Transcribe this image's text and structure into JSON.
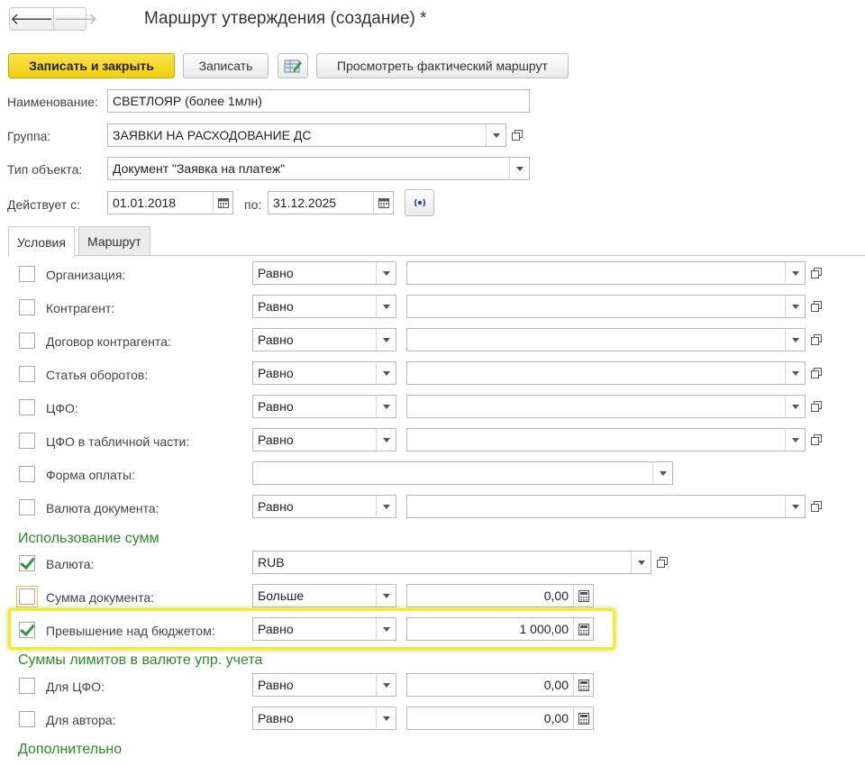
{
  "window": {
    "title": "Маршрут утверждения (создание) *"
  },
  "nav": {
    "back_icon": "arrow-left-icon",
    "forward_icon": "arrow-right-icon",
    "back_glyph": "🡐",
    "forward_glyph": "🡒"
  },
  "toolbar": {
    "save_close": "Записать и закрыть",
    "save": "Записать",
    "edit_icon": "edit-table-icon",
    "view_route": "Просмотреть фактический маршрут"
  },
  "header": {
    "name_label": "Наименование:",
    "name_value": "СВЕТЛОЯР (более 1млн)",
    "group_label": "Группа:",
    "group_value": "ЗАЯВКИ НА РАСХОДОВАНИЕ ДС",
    "object_type_label": "Тип объекта:",
    "object_type_value": "Документ \"Заявка на платеж\"",
    "valid_from_label": "Действует с:",
    "valid_from_value": "01.01.2018",
    "valid_to_label": "по:",
    "valid_to_value": "31.12.2025"
  },
  "tabs": [
    {
      "label": "Условия",
      "active": true
    },
    {
      "label": "Маршрут",
      "active": false
    }
  ],
  "conditions": [
    {
      "label": "Организация:",
      "checked": false,
      "operator": "Равно",
      "value": ""
    },
    {
      "label": "Контрагент:",
      "checked": false,
      "operator": "Равно",
      "value": ""
    },
    {
      "label": "Договор контрагента:",
      "checked": false,
      "operator": "Равно",
      "value": ""
    },
    {
      "label": "Статья оборотов:",
      "checked": false,
      "operator": "Равно",
      "value": ""
    },
    {
      "label": "ЦФО:",
      "checked": false,
      "operator": "Равно",
      "value": ""
    },
    {
      "label": "ЦФО в табличной части:",
      "checked": false,
      "operator": "Равно",
      "value": ""
    },
    {
      "label": "Форма оплаты:",
      "checked": false,
      "value": ""
    },
    {
      "label": "Валюта документа:",
      "checked": false,
      "operator": "Равно",
      "value": ""
    }
  ],
  "amounts": {
    "title": "Использование сумм",
    "currency": {
      "label": "Валюта:",
      "checked": true,
      "value": "RUB"
    },
    "doc_sum": {
      "label": "Сумма документа:",
      "checked": false,
      "operator": "Больше",
      "value": "0,00"
    },
    "budget_excess": {
      "label": "Превышение над бюджетом:",
      "checked": true,
      "operator": "Равно",
      "value": "1 000,00"
    }
  },
  "limits": {
    "title": "Суммы лимитов в валюте упр. учета",
    "for_cfo": {
      "label": "Для ЦФО:",
      "checked": false,
      "operator": "Равно",
      "value": "0,00"
    },
    "for_author": {
      "label": "Для автора:",
      "checked": false,
      "operator": "Равно",
      "value": "0,00"
    }
  },
  "additional": {
    "title": "Дополнительно"
  },
  "colors": {
    "primary_button": "#f5d31a",
    "section_heading": "#2a8a2a",
    "checkmark": "#2b9a3e",
    "highlight": "#f2ee25"
  }
}
